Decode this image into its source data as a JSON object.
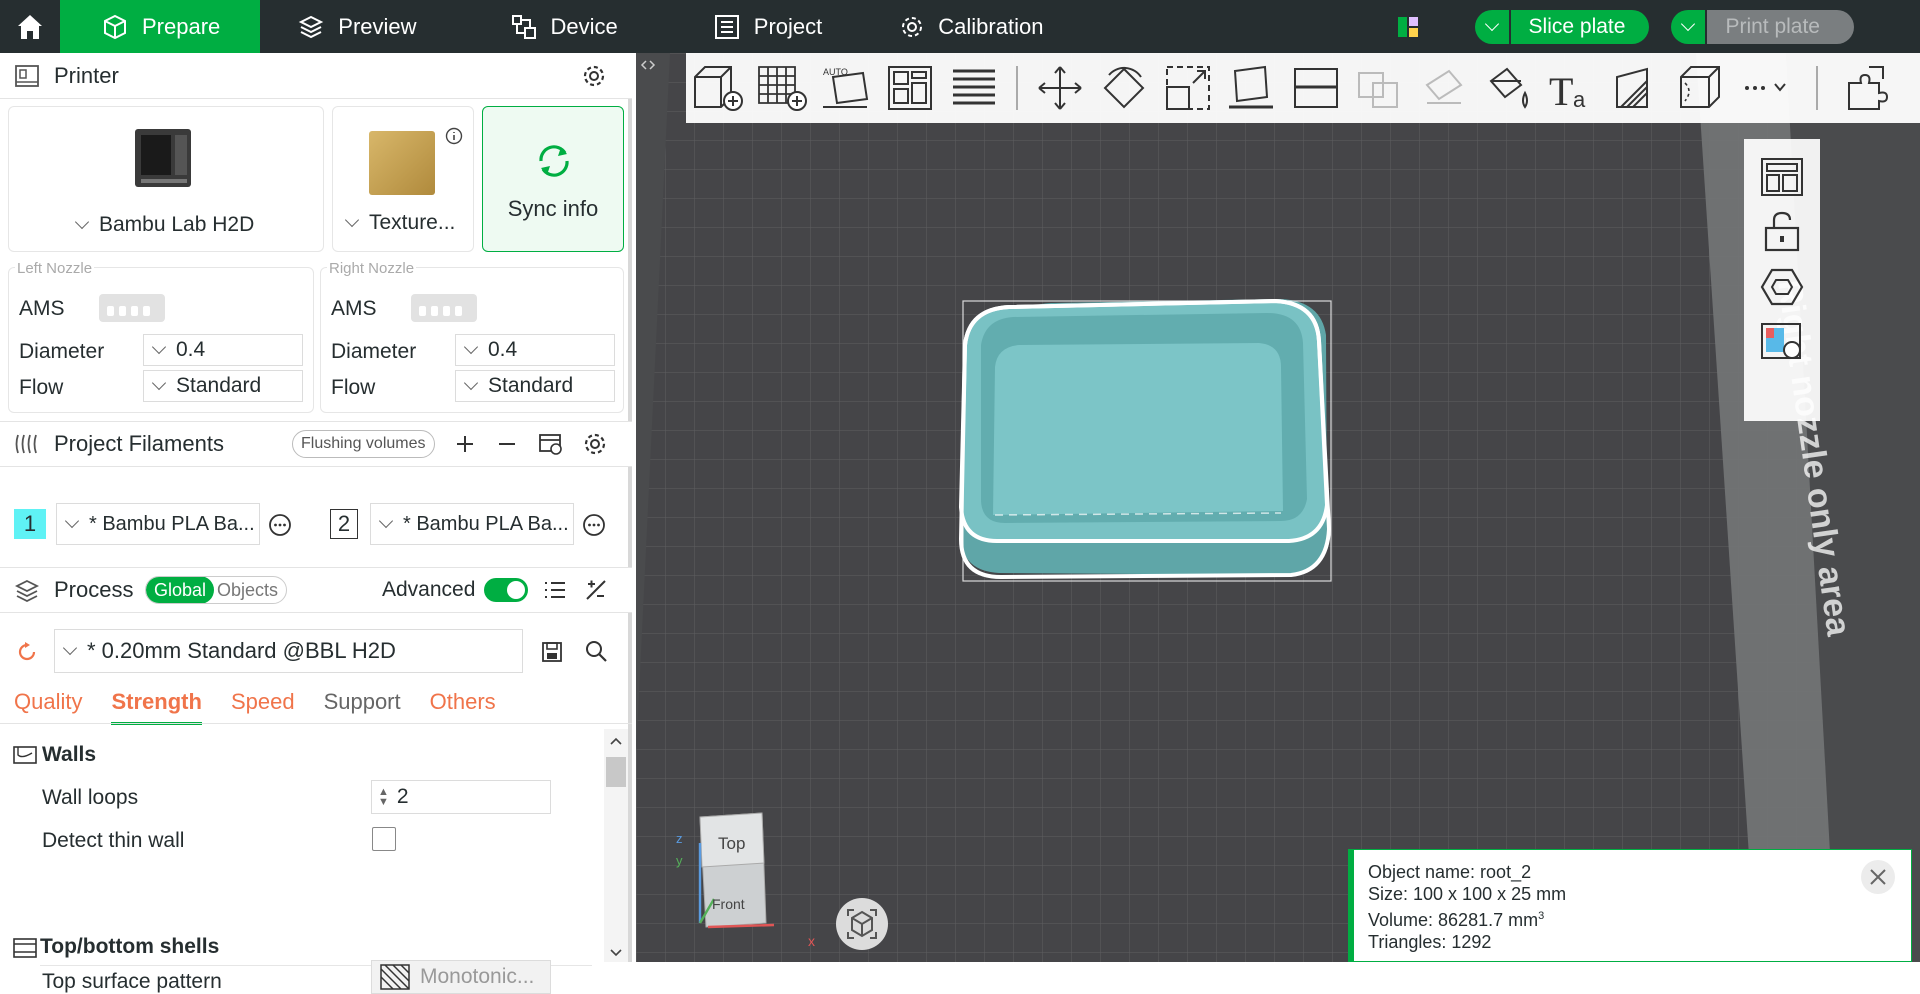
{
  "nav": {
    "tabs": [
      {
        "label": "Prepare",
        "icon": "cube-icon"
      },
      {
        "label": "Preview",
        "icon": "layers-icon"
      },
      {
        "label": "Device",
        "icon": "device-icon"
      },
      {
        "label": "Project",
        "icon": "list-icon"
      },
      {
        "label": "Calibration",
        "icon": "gear-icon"
      }
    ],
    "slice_label": "Slice plate",
    "print_label": "Print plate",
    "colors": {
      "topbar": "#262e30",
      "accent": "#00ae42"
    }
  },
  "printer": {
    "title": "Printer",
    "model": "Bambu Lab H2D",
    "plate": "Texture...",
    "sync_label": "Sync info",
    "left_nozzle": {
      "title": "Left Nozzle",
      "ams": "AMS",
      "diameter_label": "Diameter",
      "diameter": "0.4",
      "flow_label": "Flow",
      "flow": "Standard"
    },
    "right_nozzle": {
      "title": "Right Nozzle",
      "ams": "AMS",
      "diameter_label": "Diameter",
      "diameter": "0.4",
      "flow_label": "Flow",
      "flow": "Standard"
    }
  },
  "filaments": {
    "title": "Project Filaments",
    "flushing_label": "Flushing volumes",
    "items": [
      {
        "index": "1",
        "name": "* Bambu PLA Ba...",
        "color": "#5ff2f5"
      },
      {
        "index": "2",
        "name": "* Bambu PLA Ba...",
        "color": "#ffffff"
      }
    ]
  },
  "process": {
    "title": "Process",
    "toggle_global": "Global",
    "toggle_objects": "Objects",
    "advanced_label": "Advanced",
    "advanced_on": true,
    "preset": "* 0.20mm Standard @BBL H2D",
    "tabs": [
      "Quality",
      "Strength",
      "Speed",
      "Support",
      "Others"
    ],
    "active_tab": "Strength",
    "groups": [
      {
        "title": "Walls"
      },
      {
        "title": "Top/bottom shells"
      }
    ],
    "wall_loops_label": "Wall loops",
    "wall_loops": "2",
    "detect_thin_wall_label": "Detect thin wall",
    "top_surface_pattern_label": "Top surface pattern",
    "top_surface_pattern": "Monotonic..."
  },
  "viewport": {
    "plate_label": "Right nozzle only area",
    "view_cube": {
      "top": "Top",
      "front": "Front"
    },
    "object_info": {
      "name": "Object name: root_2",
      "size": "Size: 100 x 100 x 25 mm",
      "volume": "Volume: 86281.7 mm",
      "volume_sup": "3",
      "triangles": "Triangles: 1292"
    },
    "model_color": "#6fc3c5"
  }
}
